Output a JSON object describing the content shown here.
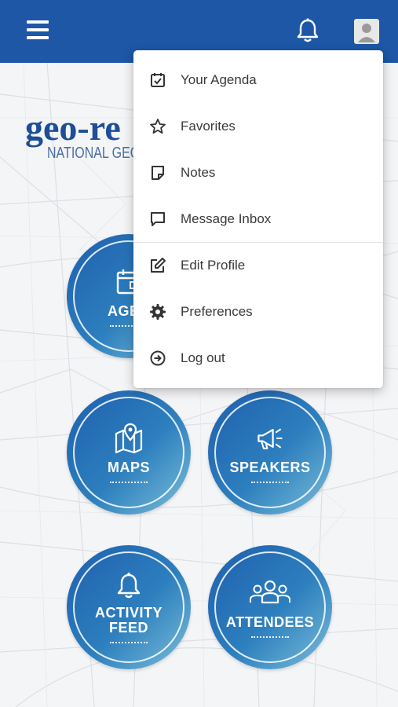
{
  "header": {
    "accent_color": "#1d57a6",
    "menu_icon": "hamburger-menu-icon",
    "notification_icon": "bell-icon",
    "avatar_icon": "user-avatar-icon"
  },
  "logo": {
    "main_text": "geo-re",
    "sub_text": "NATIONAL GEOS"
  },
  "tiles": [
    {
      "label": "AGEN",
      "icon": "calendar-icon"
    },
    {
      "label": "MAPS",
      "icon": "map-pin-icon"
    },
    {
      "label": "SPEAKERS",
      "icon": "megaphone-icon"
    },
    {
      "label": "ACTIVITY\nFEED",
      "icon": "bell-icon"
    },
    {
      "label": "ATTENDEES",
      "icon": "people-icon"
    }
  ],
  "dropdown": {
    "items": [
      {
        "label": "Your Agenda",
        "icon": "calendar-check-icon"
      },
      {
        "label": "Favorites",
        "icon": "star-icon"
      },
      {
        "label": "Notes",
        "icon": "note-icon"
      },
      {
        "label": "Message Inbox",
        "icon": "message-icon"
      },
      {
        "label": "Edit Profile",
        "icon": "edit-icon"
      },
      {
        "label": "Preferences",
        "icon": "gear-icon"
      },
      {
        "label": "Log out",
        "icon": "logout-icon"
      }
    ]
  }
}
